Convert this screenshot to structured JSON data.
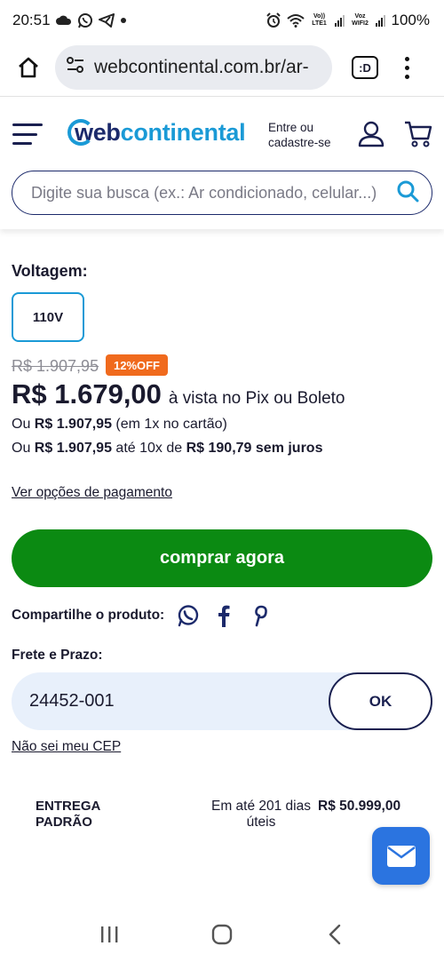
{
  "status_bar": {
    "time": "20:51",
    "left_icons": [
      "cloud-icon",
      "whatsapp-icon",
      "telegram-icon",
      "dot-icon"
    ],
    "right_icons": [
      "alarm-icon",
      "wifi-icon",
      "volte-lte1-signal-icon",
      "vowifi2-signal-icon"
    ],
    "lte_label": "Vo)) LTE1",
    "wifi_label": "Voz WIFI2",
    "battery": "100%"
  },
  "browser": {
    "url": "webcontinental.com.br/ar-",
    "tabs_label": ":D",
    "icons": [
      "home-icon",
      "site-settings-icon",
      "tabs-icon",
      "more-vert-icon"
    ]
  },
  "header": {
    "logo_part1": "web",
    "logo_part2": "continental",
    "login_line1": "Entre ou",
    "login_line2": "cadastre-se",
    "search_placeholder": "Digite sua busca (ex.: Ar condicionado, celular...)",
    "icons": [
      "menu-icon",
      "user-icon",
      "cart-icon",
      "search-icon"
    ]
  },
  "product": {
    "voltage_label": "Voltagem:",
    "voltage_options": [
      "110V"
    ],
    "old_price": "R$ 1.907,95",
    "discount_badge": "12%OFF",
    "price": "R$ 1.679,00",
    "price_note": "à vista no Pix ou Boleto",
    "card_line": {
      "prefix": "Ou ",
      "amount": "R$ 1.907,95",
      "suffix": " (em 1x no cartão)"
    },
    "installment_line": {
      "prefix": "Ou ",
      "amount": "R$ 1.907,95",
      "middle": " até 10x de ",
      "installment": "R$ 190,79 sem juros"
    },
    "payment_options_link": "Ver opções de pagamento",
    "buy_button": "comprar agora",
    "share_label": "Compartilhe o produto:",
    "share_icons": [
      "whatsapp-icon",
      "facebook-icon",
      "pinterest-icon"
    ]
  },
  "shipping": {
    "label": "Frete e Prazo:",
    "cep_value": "24452-001",
    "ok_button": "OK",
    "unknown_cep_link": "Não sei meu CEP",
    "option": {
      "name_line1": "ENTREGA",
      "name_line2": "PADRÃO",
      "time_line1": "Em até 201 dias",
      "time_line2": "úteis",
      "price": "R$ 50.999,00"
    }
  },
  "colors": {
    "brand_navy": "#1c2a6b",
    "brand_blue": "#1a9ad6",
    "buy_green": "#0b8a12",
    "discount_orange": "#f06a1d",
    "chat_blue": "#2b74e0",
    "cep_bg": "#e8f0fb"
  },
  "nav_bar": {
    "icons": [
      "recents-icon",
      "home-nav-icon",
      "back-icon"
    ]
  }
}
